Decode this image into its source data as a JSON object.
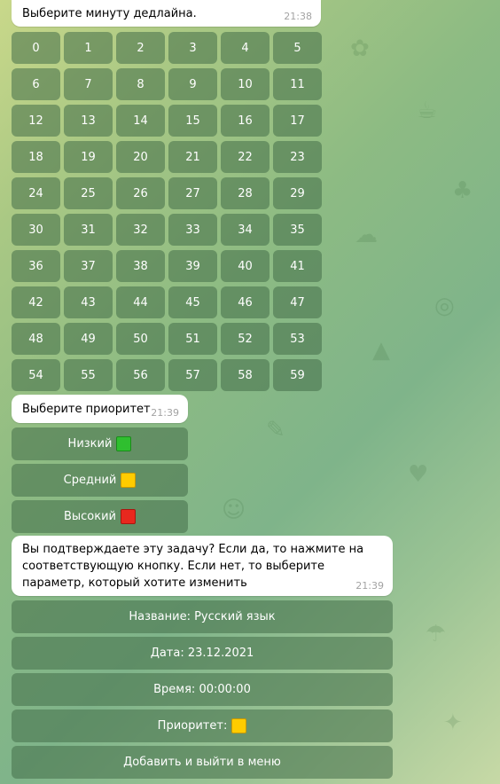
{
  "messages": {
    "minute_prompt": {
      "text": "Выберите минуту дедлайна.",
      "time": "21:38"
    },
    "priority_prompt": {
      "text": "Выберите приоритет",
      "time": "21:39"
    },
    "confirm_prompt": {
      "text": "Вы подтверждаете эту задачу? Если да, то нажмите на соответствующую кнопку. Если нет, то выберите параметр, который хотите изменить",
      "time": "21:39"
    }
  },
  "minutes": [
    "0",
    "1",
    "2",
    "3",
    "4",
    "5",
    "6",
    "7",
    "8",
    "9",
    "10",
    "11",
    "12",
    "13",
    "14",
    "15",
    "16",
    "17",
    "18",
    "19",
    "20",
    "21",
    "22",
    "23",
    "24",
    "25",
    "26",
    "27",
    "28",
    "29",
    "30",
    "31",
    "32",
    "33",
    "34",
    "35",
    "36",
    "37",
    "38",
    "39",
    "40",
    "41",
    "42",
    "43",
    "44",
    "45",
    "46",
    "47",
    "48",
    "49",
    "50",
    "51",
    "52",
    "53",
    "54",
    "55",
    "56",
    "57",
    "58",
    "59"
  ],
  "priority_buttons": {
    "low": {
      "label": "Низкий",
      "color": "#2fbf2f"
    },
    "medium": {
      "label": "Средний",
      "color": "#ffcc00"
    },
    "high": {
      "label": "Высокий",
      "color": "#e8281e"
    }
  },
  "confirm_buttons": {
    "name": "Название: Русский язык",
    "date": "Дата: 23.12.2021",
    "time": "Время: 00:00:00",
    "priority": "Приоритет:",
    "priority_color": "#ffcc00",
    "finish": "Добавить и выйти в меню"
  }
}
